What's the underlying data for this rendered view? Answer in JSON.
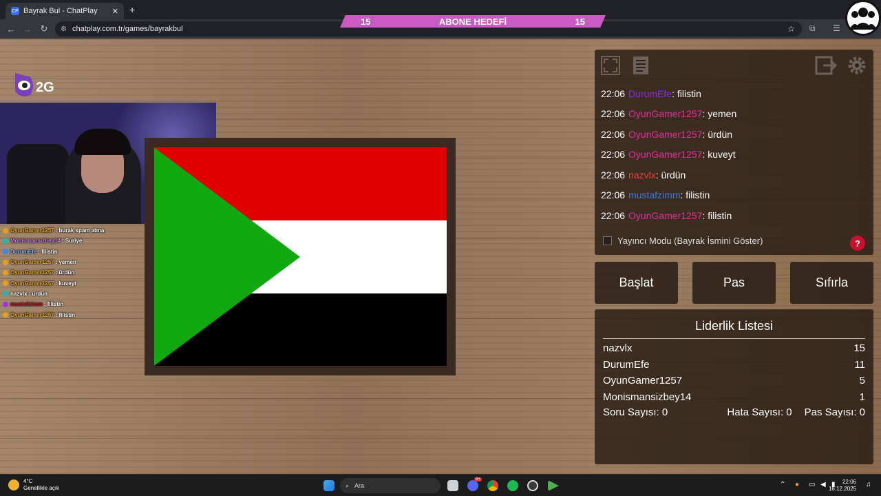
{
  "browser": {
    "tab_title": "Bayrak Bul - ChatPlay",
    "tab_favicon": "CP",
    "url": "chatplay.com.tr/games/bayrakbul"
  },
  "goal_banner": {
    "left_count": "15",
    "title": "ABONE HEDEFİ",
    "right_count": "15"
  },
  "stream_overlay_chat": [
    {
      "user": "OyunGamer1257",
      "msg": ": burak spam atma",
      "color": "#e0a020"
    },
    {
      "user": "Monismansizbey14",
      "msg": ": Suriye",
      "color": "#c07ae0"
    },
    {
      "user": "DurumEfe",
      "msg": ": filistin",
      "color": "#8ab0ff"
    },
    {
      "user": "OyunGamer1257",
      "msg": ": yemen",
      "color": "#e0a020"
    },
    {
      "user": "OyunGamer1257",
      "msg": ": ürdün",
      "color": "#e0a020"
    },
    {
      "user": "OyunGamer1257",
      "msg": ": kuveyt",
      "color": "#e0a020"
    },
    {
      "user": "nazvlx",
      "msg": ": ürdün",
      "color": "#ffffff"
    },
    {
      "user": "mustafzimm",
      "msg": ": filistin",
      "color": "#c8102e"
    },
    {
      "user": "OyunGamer1257",
      "msg": ": filistin",
      "color": "#e0a020"
    }
  ],
  "chat": [
    {
      "time": "22:06",
      "user": "DurumEfe",
      "msg": ": filistin",
      "color": "#8a2be2"
    },
    {
      "time": "22:06",
      "user": "OyunGamer1257",
      "msg": ": yemen",
      "color": "#e0309a"
    },
    {
      "time": "22:06",
      "user": "OyunGamer1257",
      "msg": ": ürdün",
      "color": "#e0309a"
    },
    {
      "time": "22:06",
      "user": "OyunGamer1257",
      "msg": ": kuveyt",
      "color": "#e0309a"
    },
    {
      "time": "22:06",
      "user": "nazvlx",
      "msg": ": ürdün",
      "color": "#e8403a"
    },
    {
      "time": "22:06",
      "user": "mustafzimm",
      "msg": ": filistin",
      "color": "#3a7ae0"
    },
    {
      "time": "22:06",
      "user": "OyunGamer1257",
      "msg": ": filistin",
      "color": "#e0309a"
    }
  ],
  "controls": {
    "streamer_mode": "Yayıncı Modu (Bayrak İsmini Göster)",
    "help": "?",
    "start": "Başlat",
    "pass": "Pas",
    "reset": "Sıfırla"
  },
  "leaderboard": {
    "title": "Liderlik Listesi",
    "rows": [
      {
        "name": "nazvlx",
        "score": "15"
      },
      {
        "name": "DurumEfe",
        "score": "11"
      },
      {
        "name": "OyunGamer1257",
        "score": "5"
      },
      {
        "name": "Monismansizbey14",
        "score": "1"
      }
    ],
    "question_count": "Soru Sayısı: 0",
    "error_count": "Hata Sayısı: 0",
    "pass_count": "Pas Sayısı: 0"
  },
  "taskbar": {
    "temp": "4°C",
    "weather": "Genellikle açık",
    "search": "Ara",
    "time": "22:06",
    "date": "16.12.2025",
    "discord_badge": "9+"
  },
  "colors": {
    "flag_red": "#e00000",
    "flag_white": "#ffffff",
    "flag_black": "#000000",
    "flag_green": "#12a812",
    "goal_pink": "#c85ac2"
  }
}
